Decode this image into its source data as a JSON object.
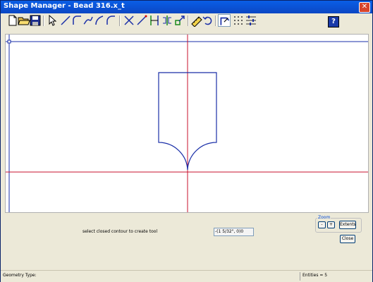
{
  "window": {
    "title": "Shape Manager - Bead 316.x_t"
  },
  "toolbar": {
    "tools": [
      "new-file-icon",
      "open-folder-icon",
      "save-icon",
      "select-arrow-icon",
      "line-icon",
      "arc-corner-icon",
      "arc-3pt-icon",
      "tangent-line-icon",
      "fillet-icon",
      "trim-icon",
      "extend-line-icon",
      "dimension-icon",
      "mirror-icon",
      "move-icon",
      "measure-icon",
      "undo-icon",
      "contour-tool-icon",
      "grid-icon",
      "properties-icon"
    ],
    "help_label": "?"
  },
  "prompt": {
    "text": "select closed contour to create tool"
  },
  "coordinate": {
    "value": "-(1 5/32\", 0)0"
  },
  "zoom": {
    "label": "Zoom",
    "minus_label": "-",
    "plus_label": "+",
    "extents_label": "Extents"
  },
  "close_button": {
    "label": "Close"
  },
  "status": {
    "geometry_type": "Geometry Type:",
    "entities": "Entities = 5"
  }
}
